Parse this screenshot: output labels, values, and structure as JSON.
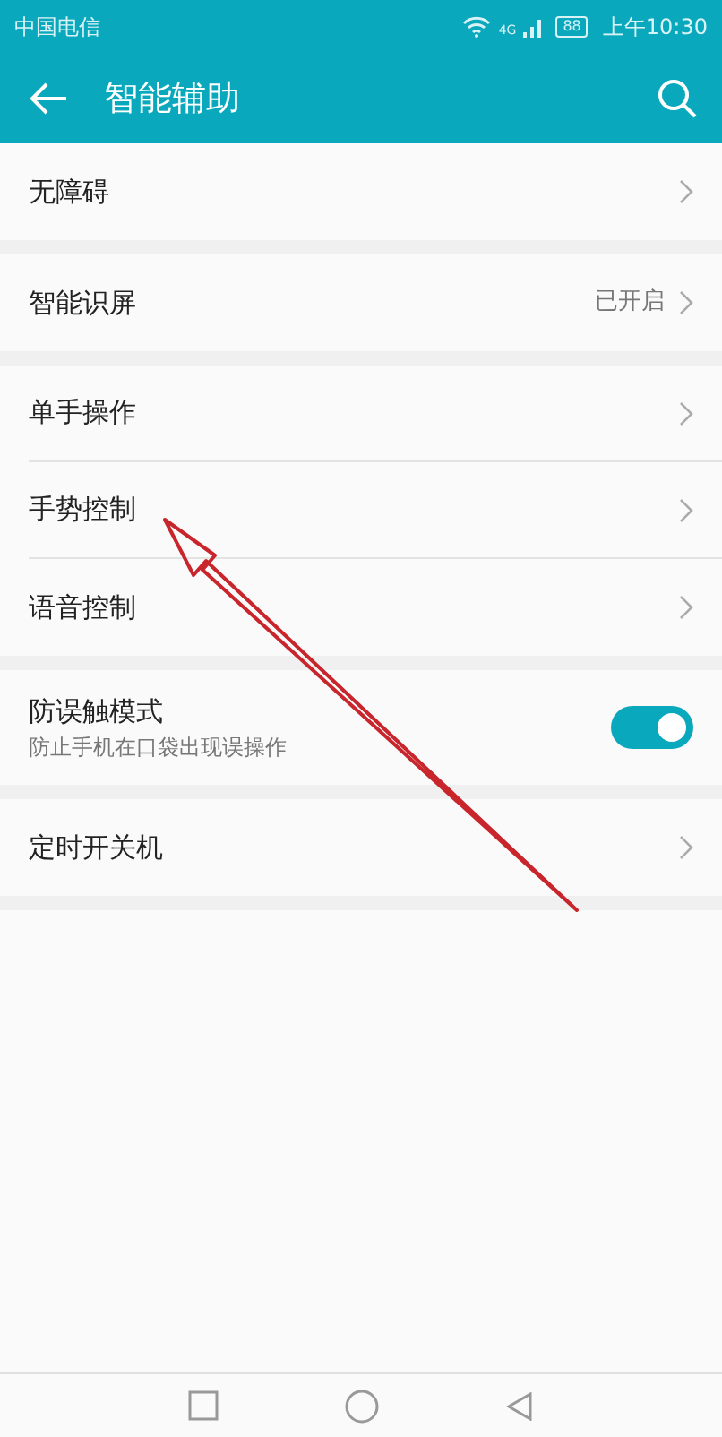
{
  "status_bar": {
    "carrier": "中国电信",
    "network": "4G",
    "battery": "88",
    "time": "上午10:30"
  },
  "title": "智能辅助",
  "groups": [
    [
      {
        "kind": "link",
        "label": "无障碍"
      }
    ],
    [
      {
        "kind": "link",
        "label": "智能识屏",
        "value": "已开启"
      }
    ],
    [
      {
        "kind": "link",
        "label": "单手操作"
      },
      {
        "kind": "link",
        "label": "手势控制"
      },
      {
        "kind": "link",
        "label": "语音控制"
      }
    ],
    [
      {
        "kind": "toggle",
        "label": "防误触模式",
        "subtitle": "防止手机在口袋出现误操作",
        "on": true
      }
    ],
    [
      {
        "kind": "link",
        "label": "定时开关机"
      }
    ]
  ]
}
